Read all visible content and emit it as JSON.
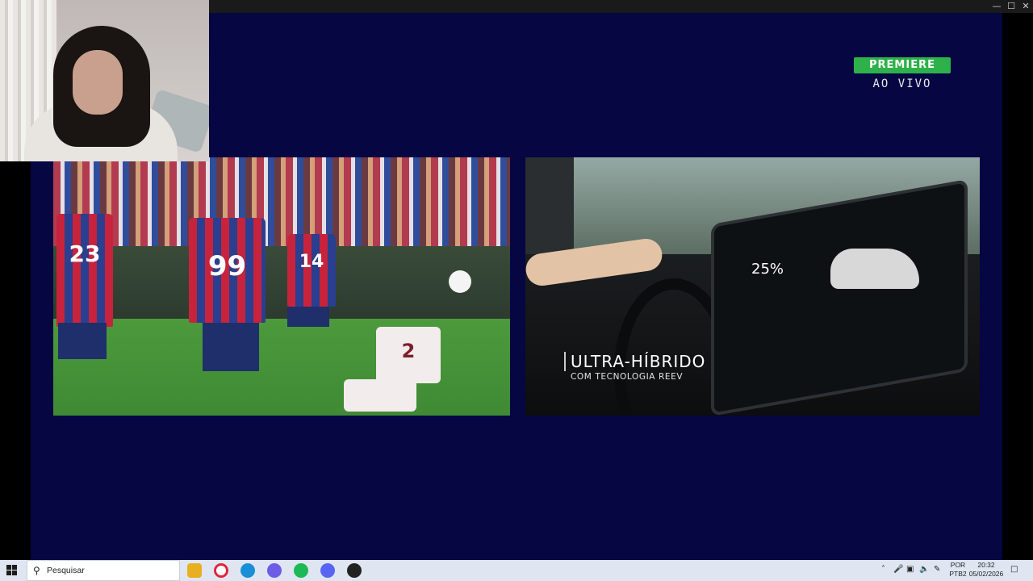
{
  "window": {
    "minimize_icon": "minimize-icon",
    "maximize_icon": "maximize-icon",
    "close_icon": "close-icon",
    "minimize_glyph": "—",
    "maximize_glyph": "☐",
    "close_glyph": "✕"
  },
  "broadcast": {
    "channel_logo": "PREMIERE",
    "live_label": "AO VIVO"
  },
  "match": {
    "players": [
      {
        "number": "23"
      },
      {
        "number": "99"
      },
      {
        "number": "14"
      },
      {
        "number": "2"
      }
    ]
  },
  "ad": {
    "title": "ULTRA-HÍBRIDO",
    "subtitle": "COM TECNOLOGIA REEV",
    "screen_percent": "25%"
  },
  "taskbar": {
    "search_placeholder": "Pesquisar",
    "apps": [
      {
        "name": "file-explorer-icon",
        "color": "#e8b020"
      },
      {
        "name": "opera-icon",
        "color": "#e0263a"
      },
      {
        "name": "edge-icon",
        "color": "#1b8fd6"
      },
      {
        "name": "copilot-icon",
        "color": "#6e5ce6"
      },
      {
        "name": "spotify-icon",
        "color": "#1db954"
      },
      {
        "name": "discord-icon",
        "color": "#5865f2"
      },
      {
        "name": "app-icon",
        "color": "#222222"
      }
    ],
    "language_line1": "POR",
    "language_line2": "PTB2",
    "time": "20:32",
    "date": "05/02/2026"
  },
  "colors": {
    "stage_background": "#050642",
    "channel_logo_background": "#2eb14a",
    "taskbar_background": "#dfe6f2"
  }
}
